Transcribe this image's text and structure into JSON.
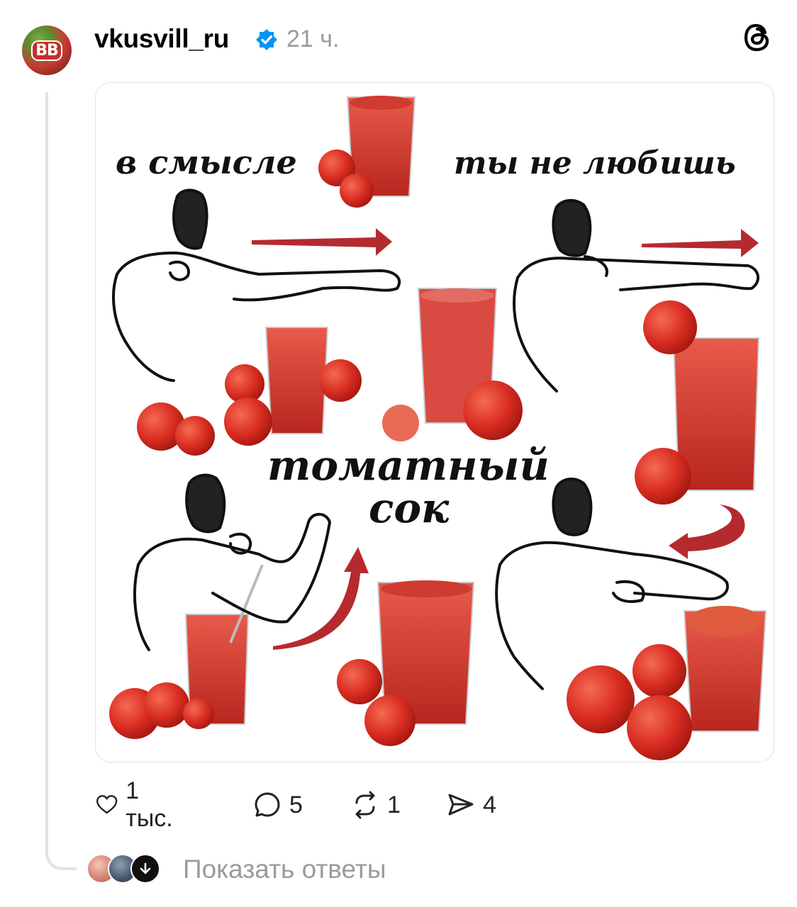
{
  "post": {
    "avatar_text": "BB",
    "username": "vkusvill_ru",
    "time": "21 ч.",
    "image_text": {
      "top_left": "в смысле",
      "top_right": "ты не любишь",
      "center_line1": "томатный",
      "center_line2": "сок"
    }
  },
  "actions": {
    "likes": "1 тыс.",
    "comments": "5",
    "reposts": "1",
    "shares": "4"
  },
  "replies": {
    "label": "Показать ответы"
  },
  "colors": {
    "verified": "#0095f6",
    "juice": "#d7362b",
    "arrow": "#b52a2f",
    "muted": "#9b9b9b"
  }
}
